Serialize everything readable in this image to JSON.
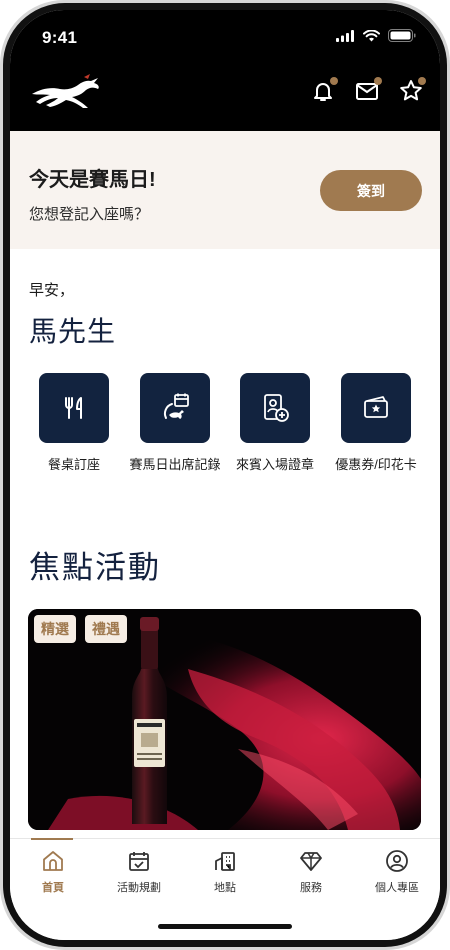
{
  "status_bar": {
    "time": "9:41"
  },
  "header": {
    "logo": "galloping-horse-logo",
    "icons": [
      "bell-icon",
      "mail-icon",
      "star-icon"
    ],
    "badge_color": "#a17a4f"
  },
  "race_day": {
    "title": "今天是賽馬日!",
    "subtitle": "您想登記入座嗎？",
    "checkin_label": "簽到"
  },
  "greeting": {
    "salutation": "早安，",
    "name": "馬先生"
  },
  "quick_actions": [
    {
      "label": "餐桌訂座",
      "icon": "fork-knife-icon"
    },
    {
      "label": "賽馬日出席記錄",
      "icon": "calendar-horse-icon"
    },
    {
      "label": "來賓入場證章",
      "icon": "guest-badge-icon"
    },
    {
      "label": "優惠券/印花卡",
      "icon": "coupon-icon"
    }
  ],
  "focus": {
    "title": "焦點活動",
    "tags": [
      "精選",
      "禮遇"
    ],
    "image": "wine-bottle-red-silk"
  },
  "bottom_nav": {
    "items": [
      {
        "label": "首頁",
        "icon": "home-icon",
        "active": true
      },
      {
        "label": "活動規劃",
        "icon": "calendar-check-icon",
        "active": false
      },
      {
        "label": "地點",
        "icon": "buildings-icon",
        "active": false
      },
      {
        "label": "服務",
        "icon": "diamond-icon",
        "active": false
      },
      {
        "label": "個人專區",
        "icon": "user-circle-icon",
        "active": false
      }
    ]
  },
  "colors": {
    "accent": "#a07a50",
    "navy": "#12233f",
    "banner_bg": "#f8f3ef",
    "header_bg": "#000000"
  }
}
